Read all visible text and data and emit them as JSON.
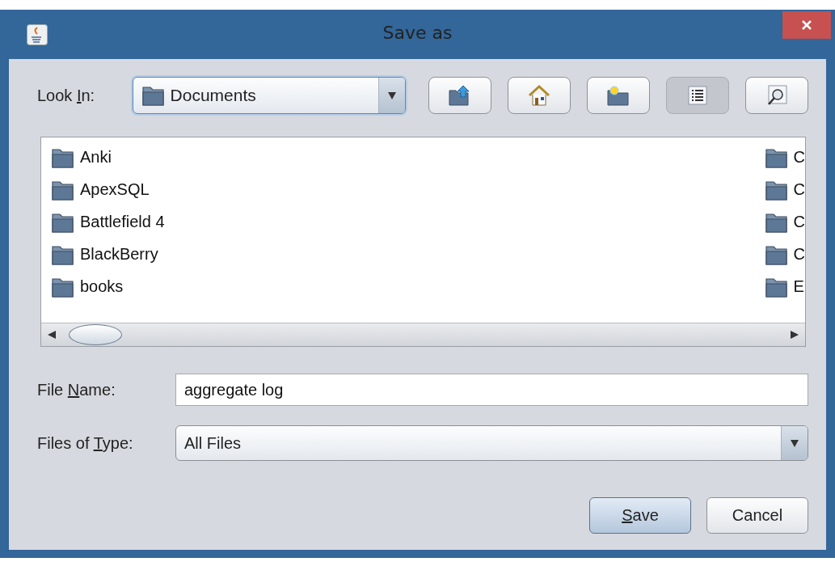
{
  "window": {
    "title": "Save as"
  },
  "look_in": {
    "label": {
      "before": "Look ",
      "key": "I",
      "after": "n:"
    },
    "value": "Documents"
  },
  "toolbar": [
    {
      "kind": "up",
      "selected": false
    },
    {
      "kind": "home",
      "selected": false
    },
    {
      "kind": "new-folder",
      "selected": false
    },
    {
      "kind": "list",
      "selected": true
    },
    {
      "kind": "details",
      "selected": false
    }
  ],
  "files": {
    "column_1": [
      "Anki",
      "ApexSQL",
      "Battlefield 4",
      "BlackBerry",
      "books"
    ],
    "column_2": [
      "C",
      "C",
      "C",
      "C",
      "E"
    ]
  },
  "file_name": {
    "label": {
      "before": "File ",
      "key": "N",
      "after": "ame:"
    },
    "value": "aggregate log"
  },
  "file_type": {
    "label": {
      "before": "Files of ",
      "key": "T",
      "after": "ype:"
    },
    "value": "All Files"
  },
  "buttons": [
    {
      "label": {
        "key": "S",
        "after": "ave"
      },
      "default": true
    },
    {
      "label": {
        "before": "Cancel"
      },
      "default": false
    }
  ]
}
